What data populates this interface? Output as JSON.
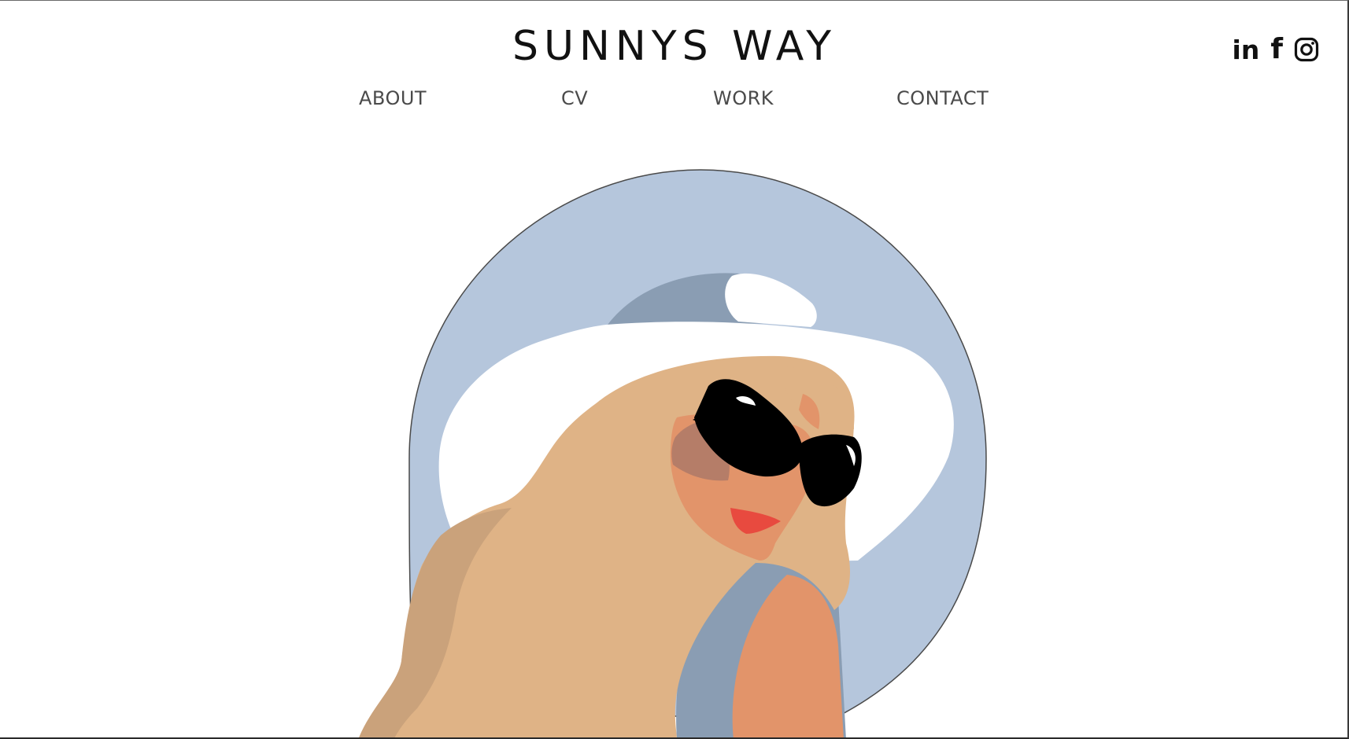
{
  "site": {
    "title": "SUNNYS WAY"
  },
  "nav": {
    "items": [
      {
        "label": "ABOUT"
      },
      {
        "label": "CV"
      },
      {
        "label": "WORK"
      },
      {
        "label": "CONTACT"
      }
    ]
  },
  "social": {
    "items": [
      {
        "icon": "linkedin-icon"
      },
      {
        "icon": "facebook-icon"
      },
      {
        "icon": "instagram-icon"
      }
    ]
  },
  "hero": {
    "image": "illustration-woman-sun-hat-sunglasses"
  },
  "colors": {
    "background": "#ffffff",
    "title": "#111111",
    "nav_text": "#4a4a4a",
    "halo": "#b5c6dc",
    "hat_band": "#8a9db3",
    "hat": "#ffffff",
    "hair": "#dfb386",
    "hair_shadow": "#caa27b",
    "skin": "#e2946a",
    "skin_shadow": "#b57d68",
    "lips": "#e84a3f",
    "sunglasses": "#000000",
    "swimsuit": "#8a9db3"
  }
}
